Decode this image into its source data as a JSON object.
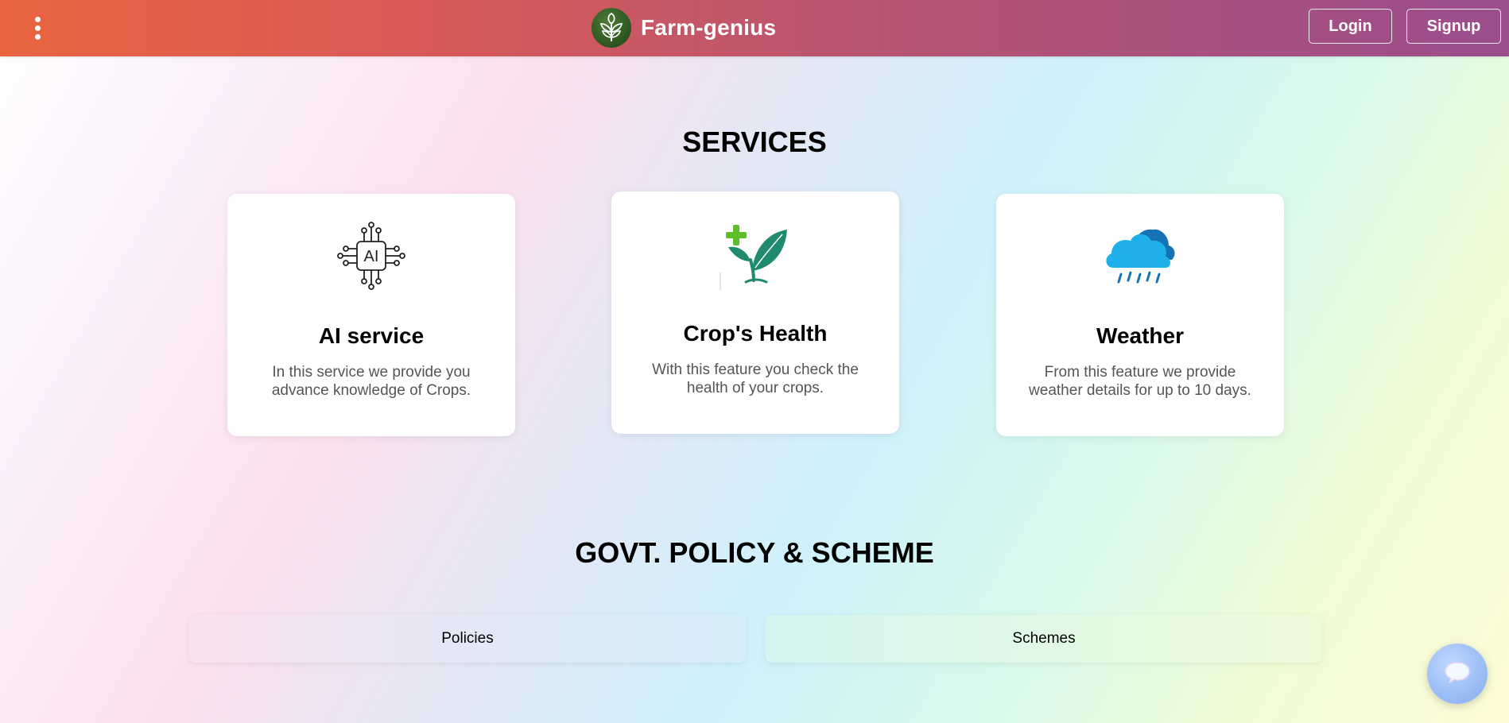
{
  "navbar": {
    "brand_name": "Farm-genius",
    "login_label": "Login",
    "signup_label": "Signup",
    "menu_icon": "kebab-menu-icon",
    "logo_icon": "leaf-sprout-logo-icon"
  },
  "services": {
    "title": "SERVICES",
    "cards": [
      {
        "icon": "ai-chip-icon",
        "title": "AI service",
        "description": "In this service we provide you advance knowledge of Crops."
      },
      {
        "icon": "plant-health-icon",
        "title": "Crop's Health",
        "description": "With this feature you check the health of your crops."
      },
      {
        "icon": "rain-cloud-icon",
        "title": "Weather",
        "description": "From this feature we provide weather details for up to 10 days."
      }
    ]
  },
  "govt": {
    "title": "GOVT. POLICY & SCHEME",
    "policies_label": "Policies",
    "schemes_label": "Schemes"
  },
  "chat": {
    "icon": "chat-bubble-icon"
  },
  "colors": {
    "navbar_start": "#e9643f",
    "navbar_end": "#9b4d8c",
    "leaf_green": "#1f8a6e",
    "plus_green": "#5fbf2a",
    "cloud_blue": "#1fb0ec",
    "cloud_dark": "#1772b5"
  }
}
